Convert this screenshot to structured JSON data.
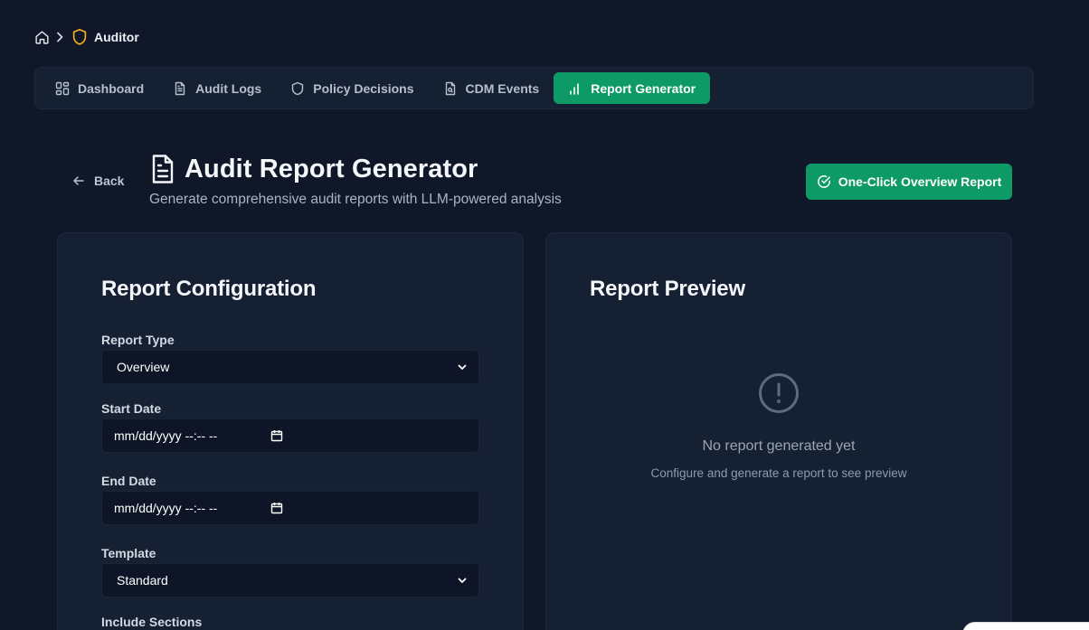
{
  "breadcrumb": {
    "home_icon": "home-icon",
    "separator_icon": "chevron-right-icon",
    "section_icon": "shield-icon",
    "current": "Auditor"
  },
  "tabs": [
    {
      "label": "Dashboard",
      "icon": "grid-icon",
      "active": false
    },
    {
      "label": "Audit Logs",
      "icon": "document-icon",
      "active": false
    },
    {
      "label": "Policy Decisions",
      "icon": "shield-icon",
      "active": false
    },
    {
      "label": "CDM Events",
      "icon": "file-search-icon",
      "active": false
    },
    {
      "label": "Report Generator",
      "icon": "bar-chart-icon",
      "active": true
    }
  ],
  "header": {
    "back_label": "Back",
    "title": "Audit Report Generator",
    "subtitle": "Generate comprehensive audit reports with LLM-powered analysis",
    "overview_button": "One-Click Overview Report"
  },
  "config": {
    "title": "Report Configuration",
    "report_type": {
      "label": "Report Type",
      "value": "Overview"
    },
    "start_date": {
      "label": "Start Date",
      "value": "mm/dd/yyyy --:-- --"
    },
    "end_date": {
      "label": "End Date",
      "value": "mm/dd/yyyy --:-- --"
    },
    "template": {
      "label": "Template",
      "value": "Standard"
    },
    "include_sections": {
      "label": "Include Sections"
    }
  },
  "preview": {
    "title": "Report Preview",
    "empty_icon": "alert-circle-icon",
    "empty_title": "No report generated yet",
    "empty_hint": "Configure and generate a report to see preview"
  },
  "colors": {
    "background": "#0f1728",
    "card": "#152033",
    "accent": "#0e9a67",
    "shield": "#f5b51d"
  }
}
